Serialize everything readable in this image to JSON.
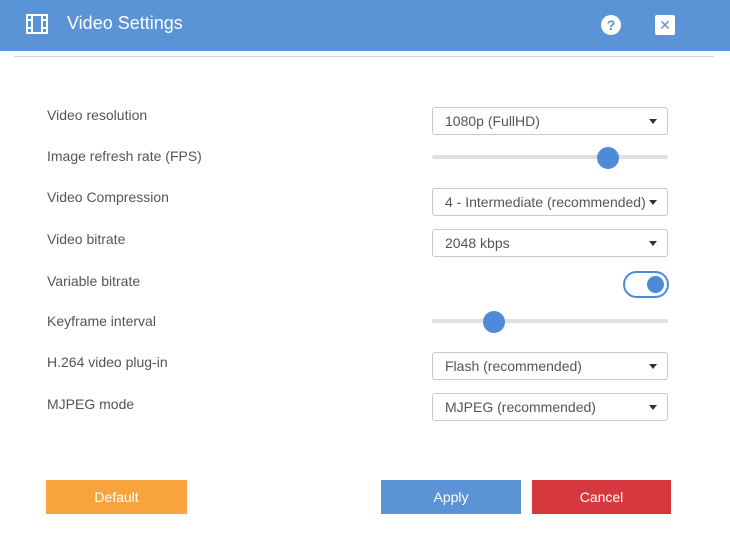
{
  "window": {
    "title": "Video Settings",
    "help_label": "?",
    "close_label": "✕",
    "icons": {
      "title": "film-icon",
      "help": "help-icon",
      "close": "close-icon"
    }
  },
  "settings": {
    "resolution": {
      "label": "Video resolution",
      "value": "1080p (FullHD)"
    },
    "fps": {
      "label": "Image refresh rate (FPS)",
      "level": 0.77
    },
    "compression": {
      "label": "Video Compression",
      "value": "4 - Intermediate (recommended)"
    },
    "bitrate": {
      "label": "Video bitrate",
      "value": "2048 kbps"
    },
    "variable_bitrate": {
      "label": "Variable bitrate",
      "on": true
    },
    "keyframe": {
      "label": "Keyframe interval",
      "level": 0.24
    },
    "plugin": {
      "label": "H.264 video plug-in",
      "value": "Flash (recommended)"
    },
    "mjpeg": {
      "label": "MJPEG mode",
      "value": "MJPEG (recommended)"
    }
  },
  "buttons": {
    "default": "Default",
    "apply": "Apply",
    "cancel": "Cancel"
  },
  "colors": {
    "header": "#5a93d6",
    "accent": "#4f8ad8",
    "default_button": "#f9a33e",
    "cancel_button": "#d6383f"
  }
}
